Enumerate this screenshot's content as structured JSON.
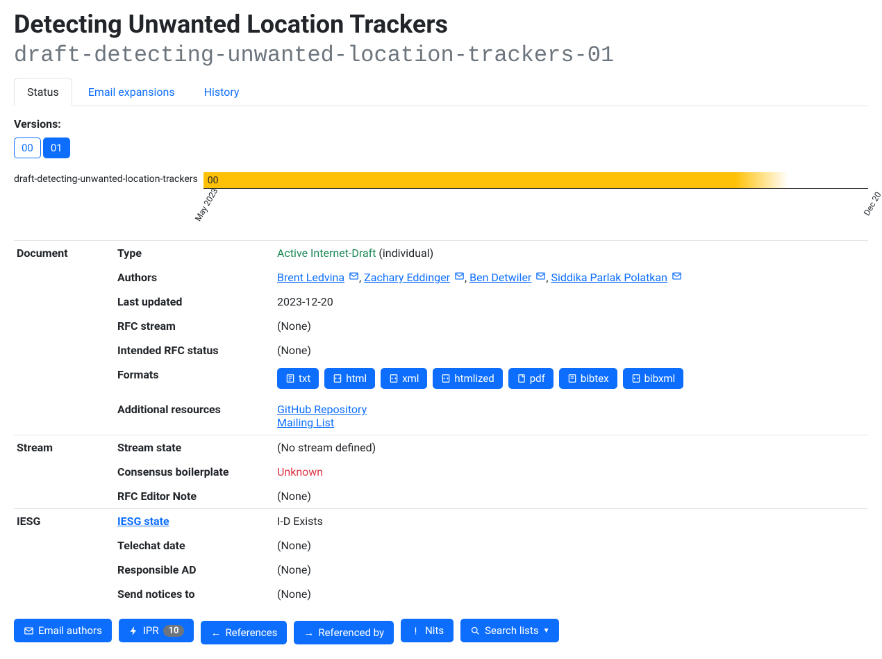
{
  "header": {
    "title": "Detecting Unwanted Location Trackers",
    "subtitle": "draft-detecting-unwanted-location-trackers-01"
  },
  "tabs": {
    "status": "Status",
    "email_expansions": "Email expansions",
    "history": "History"
  },
  "versions": {
    "label": "Versions:",
    "v00": "00",
    "v01": "01"
  },
  "timeline": {
    "draft_name": "draft-detecting-unwanted-location-trackers",
    "bar_label": "00",
    "tick_start": "May 2023",
    "tick_end": "Dec 20"
  },
  "groups": {
    "document": "Document",
    "stream": "Stream",
    "iesg": "IESG"
  },
  "labels": {
    "type": "Type",
    "authors": "Authors",
    "last_updated": "Last updated",
    "rfc_stream": "RFC stream",
    "intended_status": "Intended RFC status",
    "formats": "Formats",
    "additional_resources": "Additional resources",
    "stream_state": "Stream state",
    "consensus": "Consensus boilerplate",
    "rfc_editor_note": "RFC Editor Note",
    "iesg_state": "IESG state",
    "telechat_date": "Telechat date",
    "responsible_ad": "Responsible AD",
    "send_notices": "Send notices to"
  },
  "values": {
    "type_active": "Active Internet-Draft",
    "type_suffix": " (individual)",
    "last_updated": "2023-12-20",
    "none": "(None)",
    "no_stream": "(No stream defined)",
    "unknown": "Unknown",
    "iesg_state_val": "I-D Exists"
  },
  "authors": {
    "a1": "Brent Ledvina",
    "a2": "Zachary Eddinger",
    "a3": "Ben Detwiler",
    "a4": "Siddika Parlak Polatkan"
  },
  "formats": {
    "txt": "txt",
    "html": "html",
    "xml": "xml",
    "htmlized": "htmlized",
    "pdf": "pdf",
    "bibtex": "bibtex",
    "bibxml": "bibxml"
  },
  "resources": {
    "github": "GitHub Repository",
    "mailing": "Mailing List"
  },
  "actions": {
    "email_authors": "Email authors",
    "ipr": "IPR",
    "ipr_count": "10",
    "references": "References",
    "referenced_by": "Referenced by",
    "nits": "Nits",
    "search_lists": "Search lists"
  }
}
